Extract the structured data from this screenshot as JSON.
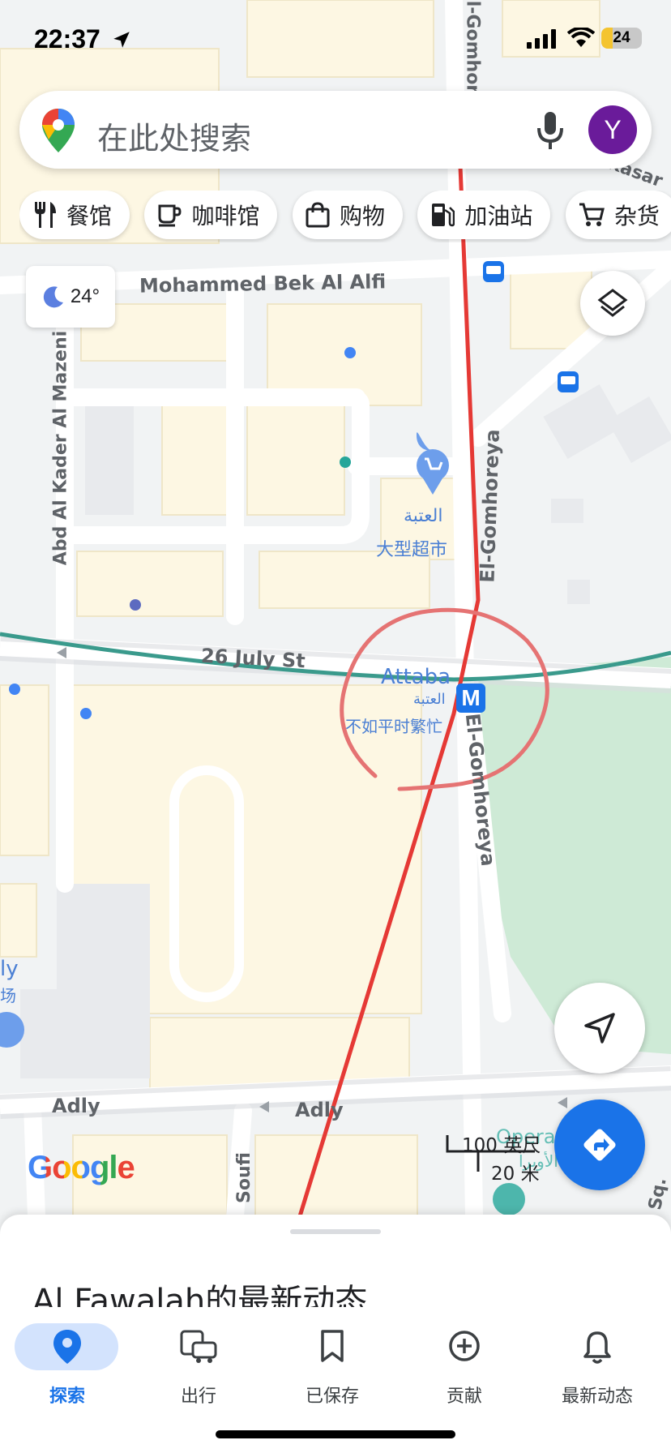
{
  "status_bar": {
    "time": "22:37",
    "battery": "24"
  },
  "search": {
    "placeholder": "在此处搜索",
    "avatar_letter": "Y"
  },
  "chips": [
    {
      "label": "餐馆",
      "icon": "fork-knife-icon"
    },
    {
      "label": "咖啡馆",
      "icon": "coffee-cup-icon"
    },
    {
      "label": "购物",
      "icon": "shopping-bag-icon"
    },
    {
      "label": "加油站",
      "icon": "gas-pump-icon"
    },
    {
      "label": "杂货",
      "icon": "cart-icon"
    }
  ],
  "weather": {
    "temp": "24°",
    "icon": "moon-icon"
  },
  "map": {
    "streets": {
      "mohammed_bek": "Mohammed Bek Al Alfi",
      "abd_al_kader": "Abd Al Kader Al Mazeni",
      "el_gomhoreya_top": "El-Gomhoreya",
      "el_gomhoreya_mid": "El-Gomhoreya",
      "el_gomhoreya_low": "El-Gomhoreya",
      "july26": "26 July St",
      "adly_left": "Adly",
      "adly_right": "Adly",
      "soufi": "Soufi",
      "kasar": "Kasar",
      "sq": "Sq."
    },
    "places": {
      "supermarket_ar": "العتبة",
      "supermarket_zh": "大型超市",
      "station_name": "Attaba",
      "station_ar": "العتبة",
      "station_busy": "不如平时繁忙",
      "station_icon": "M",
      "left_partial_1": "ly",
      "left_partial_2": "场",
      "opera_partial": "Opera",
      "opera_ar_partial": "الأوبرا"
    },
    "scale": {
      "feet": "100 英尺",
      "meters": "20 米"
    },
    "logo": "Google",
    "colors": {
      "metro_line": "#e53935",
      "green_line": "#3a9a8c",
      "annotation": "#e57373",
      "accent": "#1a73e8"
    }
  },
  "sheet": {
    "title": "Al Fawalah的最新动态"
  },
  "nav": [
    {
      "label": "探索",
      "icon": "pin-icon",
      "active": true
    },
    {
      "label": "出行",
      "icon": "commute-icon",
      "active": false
    },
    {
      "label": "已保存",
      "icon": "bookmark-icon",
      "active": false
    },
    {
      "label": "贡献",
      "icon": "add-circle-icon",
      "active": false
    },
    {
      "label": "最新动态",
      "icon": "bell-icon",
      "active": false
    }
  ]
}
